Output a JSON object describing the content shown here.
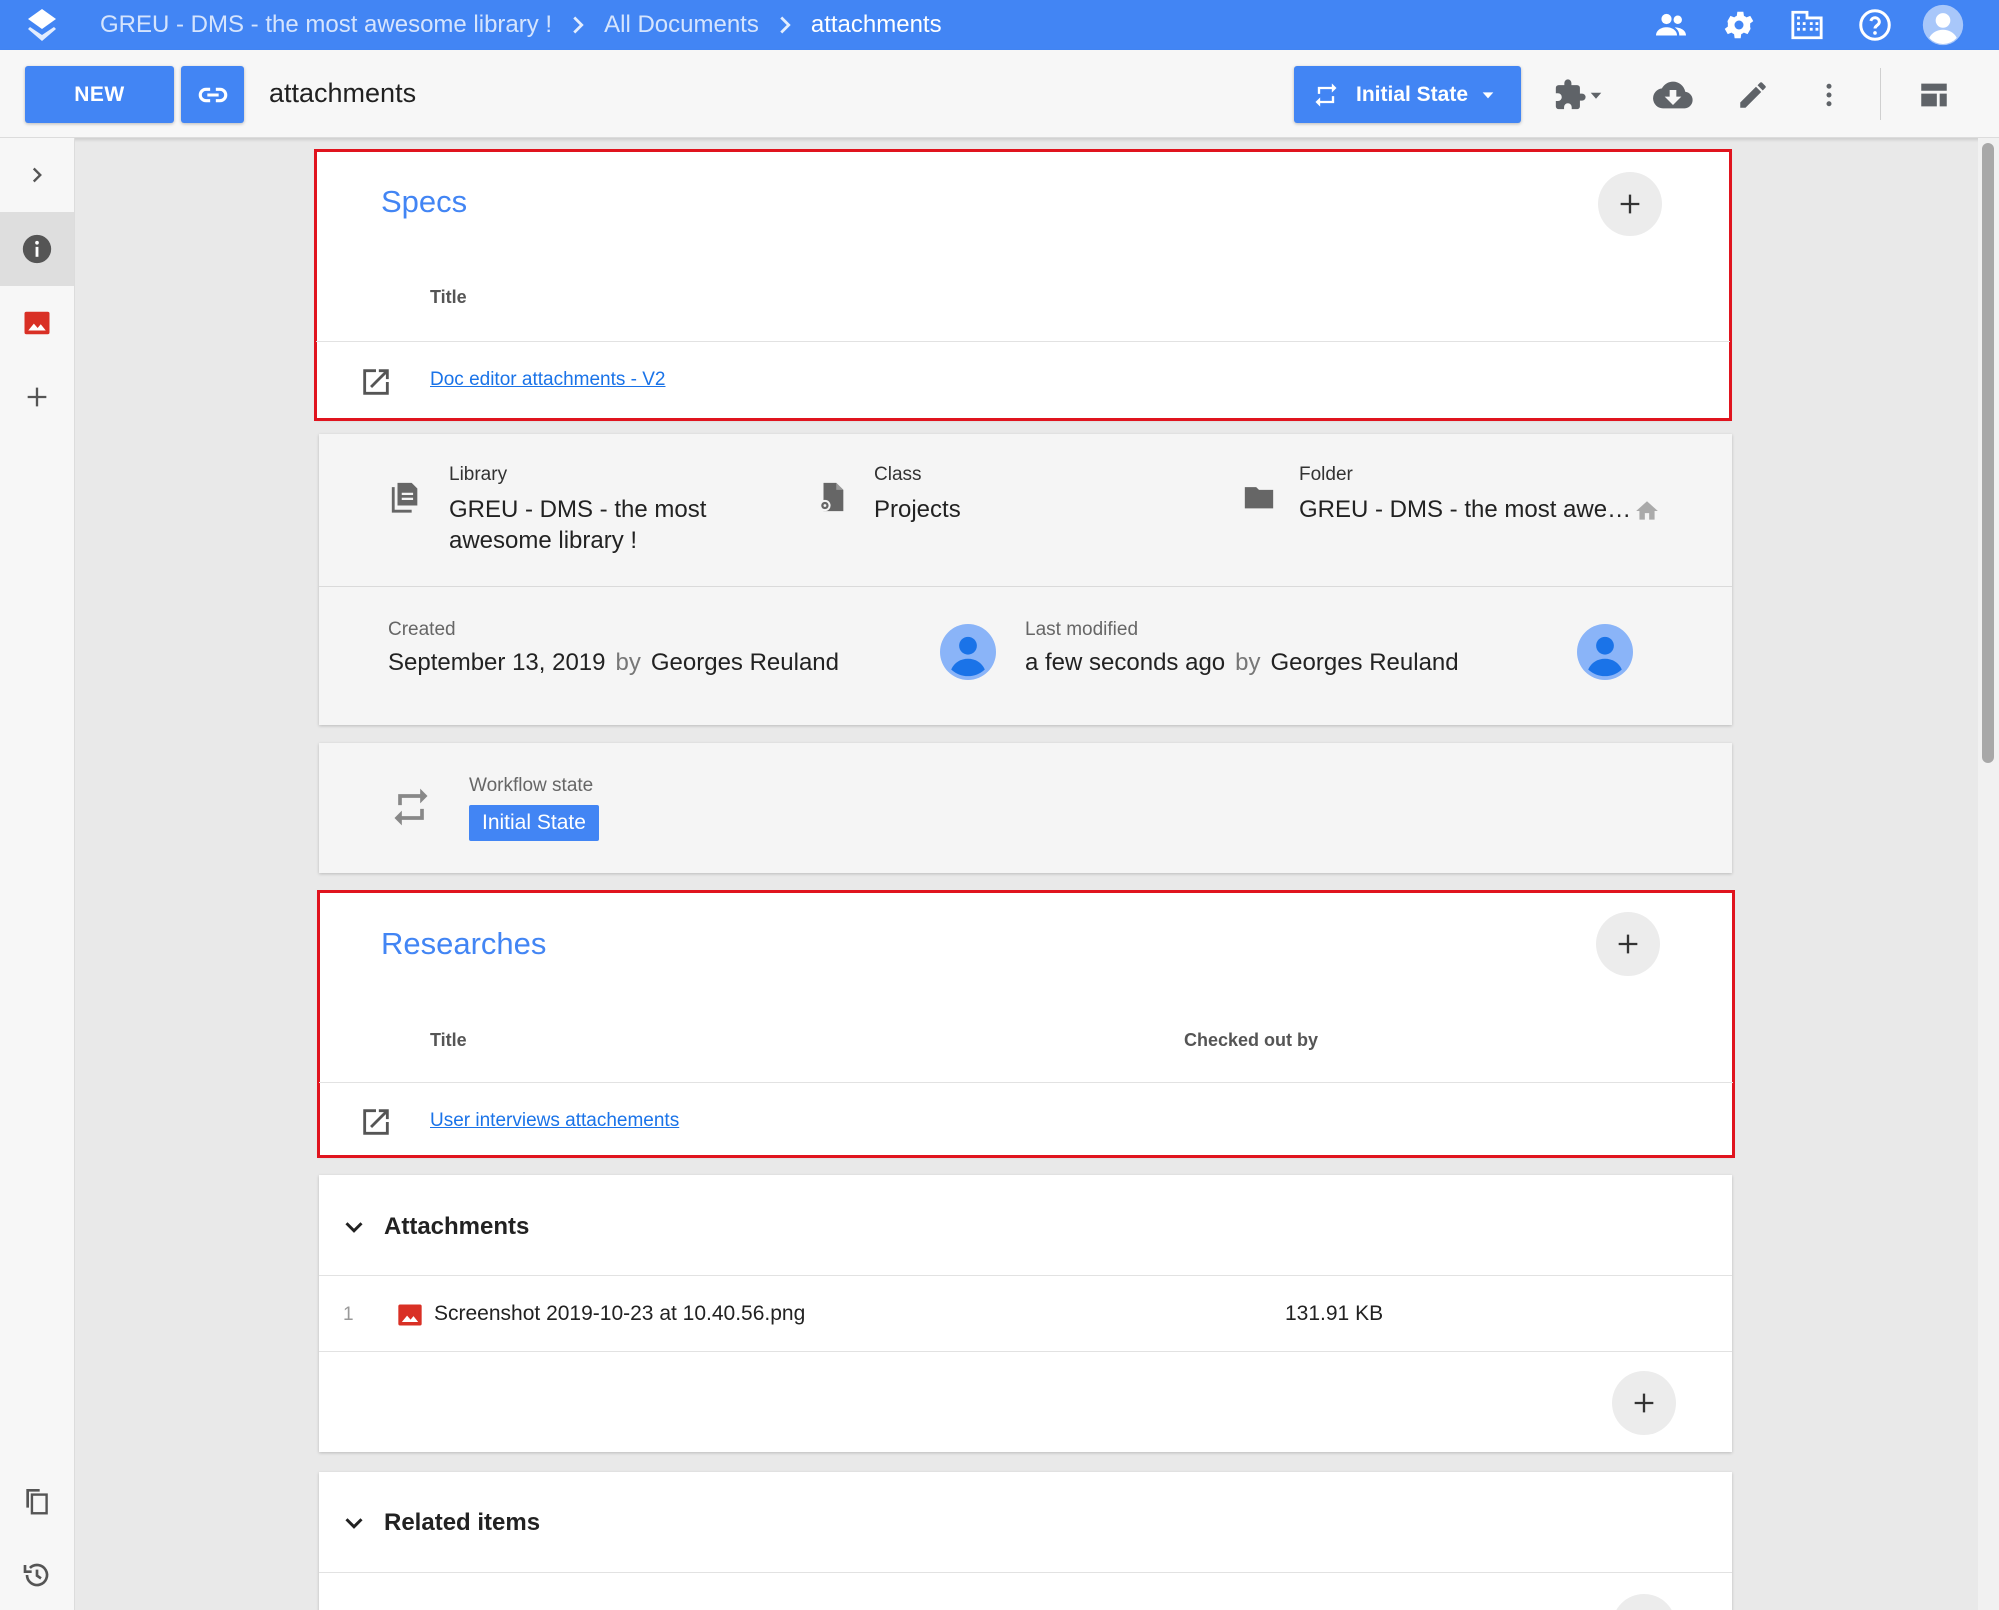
{
  "breadcrumb": [
    {
      "label": "GREU - DMS - the most awesome library !"
    },
    {
      "label": "All Documents"
    },
    {
      "label": "attachments"
    }
  ],
  "toolbar": {
    "new_label": "NEW",
    "doc_title": "attachments",
    "state_label": "Initial State"
  },
  "specs": {
    "title": "Specs",
    "col_title": "Title",
    "rows": [
      {
        "title": "Doc editor attachments - V2"
      }
    ]
  },
  "info": {
    "library_label": "Library",
    "library_value": "GREU - DMS - the most awesome library !",
    "class_label": "Class",
    "class_value": "Projects",
    "folder_label": "Folder",
    "folder_value": "GREU - DMS - the most awe…",
    "created_label": "Created",
    "created_date": "September 13, 2019",
    "created_by_word": "by",
    "created_by": "Georges Reuland",
    "modified_label": "Last modified",
    "modified_date": "a few seconds ago",
    "modified_by_word": "by",
    "modified_by": "Georges Reuland"
  },
  "workflow": {
    "label": "Workflow state",
    "state": "Initial State"
  },
  "researches": {
    "title": "Researches",
    "col_title": "Title",
    "col_checked_out": "Checked out by",
    "rows": [
      {
        "title": "User interviews attachements",
        "checked_out_by": ""
      }
    ]
  },
  "attachments": {
    "title": "Attachments",
    "items": [
      {
        "index": "1",
        "name": "Screenshot 2019-10-23 at 10.40.56.png",
        "size": "131.91 KB"
      }
    ]
  },
  "related": {
    "title": "Related items"
  },
  "colors": {
    "accent": "#4285f4",
    "highlight": "#e0141e",
    "image_icon": "#d93025"
  }
}
